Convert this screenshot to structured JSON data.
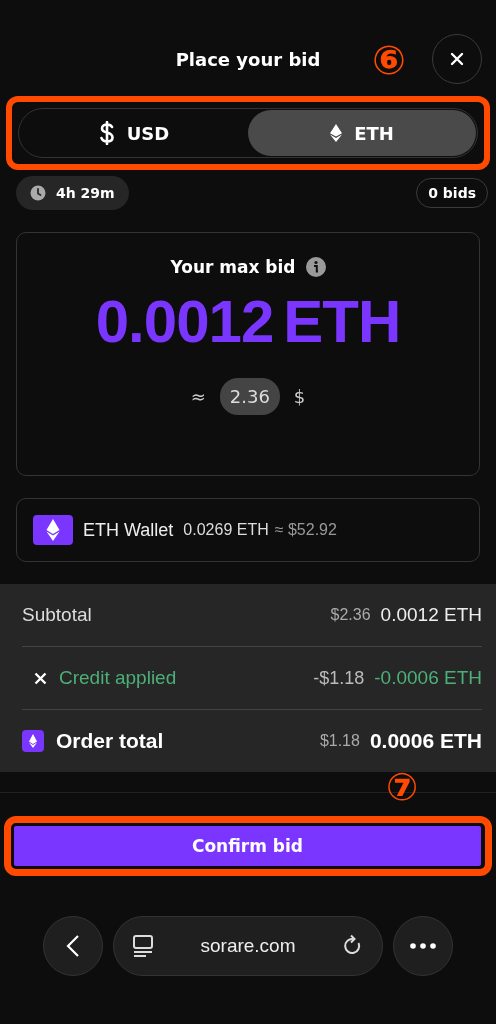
{
  "header": {
    "title": "Place your bid",
    "step_marker": "⑥"
  },
  "currency_toggle": {
    "highlighted": true,
    "options": [
      {
        "kind": "usd",
        "label": "USD",
        "selected": false
      },
      {
        "kind": "eth",
        "label": "ETH",
        "selected": true
      }
    ]
  },
  "time_left": "4h 29m",
  "bids": "0 bids",
  "max_bid": {
    "label": "Your max bid",
    "amount": "0.0012",
    "unit": "ETH",
    "approx_sign": "≈",
    "fiat_value": "2.36",
    "fiat_symbol": "$"
  },
  "wallet": {
    "name": "ETH Wallet",
    "balance": "0.0269 ETH",
    "approx": "≈ $52.92"
  },
  "summary": [
    {
      "kind": "subtotal",
      "label": "Subtotal",
      "fiat": "$2.36",
      "eth": "0.0012 ETH"
    },
    {
      "kind": "credit",
      "label": "Credit applied",
      "fiat": "-$1.18",
      "eth": "-0.0006 ETH"
    },
    {
      "kind": "total",
      "label": "Order total",
      "fiat": "$1.18",
      "eth": "0.0006 ETH"
    }
  ],
  "confirm": {
    "label": "Confirm bid",
    "highlighted": true,
    "step_marker": "⑦"
  },
  "browser": {
    "url": "sorare.com"
  }
}
